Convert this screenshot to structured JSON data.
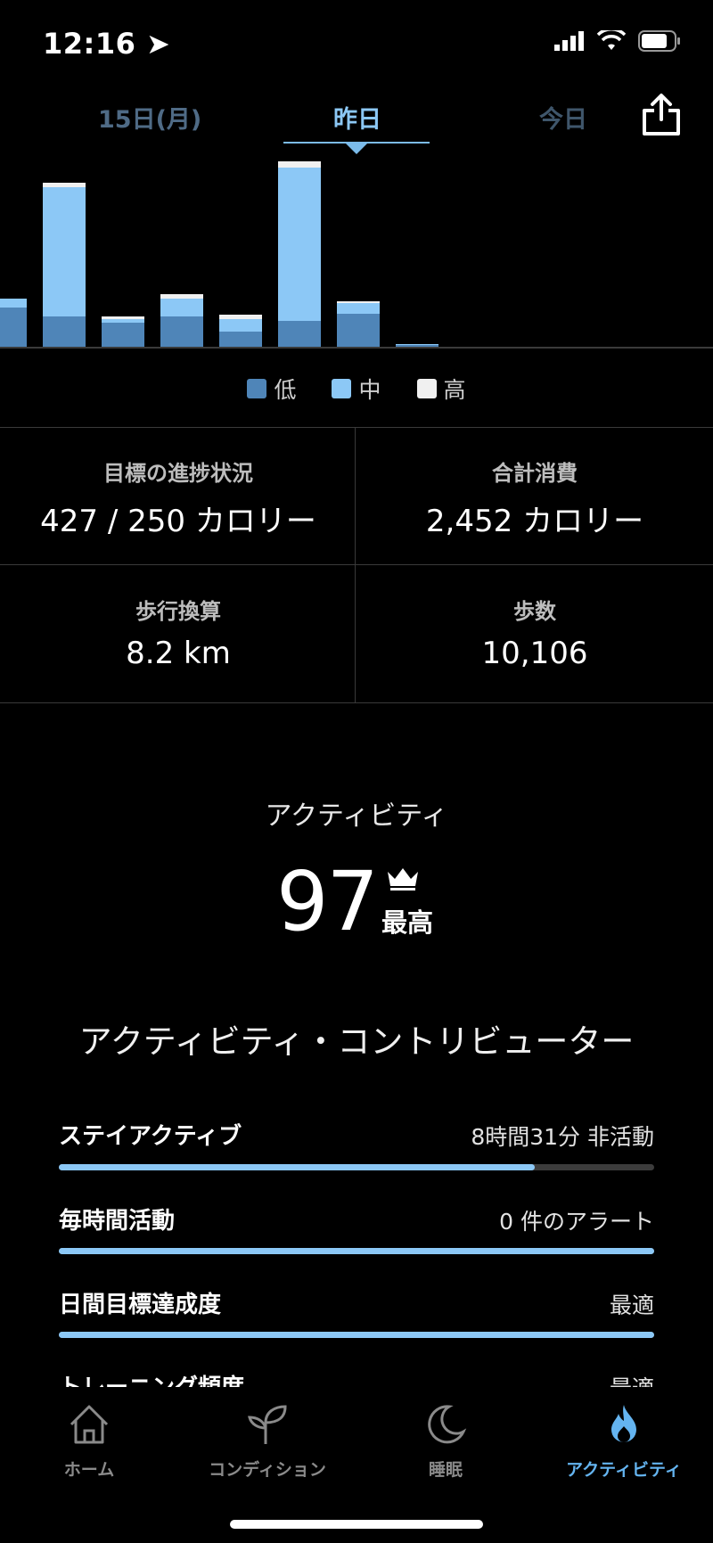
{
  "status": {
    "time": "12:16"
  },
  "date_tabs": {
    "prev": "15日(月)",
    "current": "昨日",
    "next": "今日"
  },
  "chart_data": {
    "type": "bar",
    "legend": [
      "低",
      "中",
      "高"
    ],
    "series": [
      {
        "name": "低",
        "values": [
          45,
          35,
          28,
          35,
          18,
          30,
          38,
          3
        ]
      },
      {
        "name": "中",
        "values": [
          10,
          145,
          4,
          20,
          14,
          172,
          12,
          1
        ]
      },
      {
        "name": "高",
        "values": [
          0,
          5,
          3,
          5,
          5,
          7,
          2,
          0
        ]
      }
    ],
    "colors": {
      "low": "#4f85b8",
      "mid": "#8cc8f6",
      "high": "#f0f0f0"
    }
  },
  "stats": {
    "goal_label": "目標の進捗状況",
    "goal_value": "427 / 250 カロリー",
    "total_label": "合計消費",
    "total_value": "2,452 カロリー",
    "walk_label": "歩行換算",
    "walk_value": "8.2 km",
    "steps_label": "歩数",
    "steps_value": "10,106"
  },
  "activity": {
    "title": "アクティビティ",
    "score": "97",
    "rating": "最高"
  },
  "contributors": {
    "title": "アクティビティ・コントリビューター",
    "items": [
      {
        "label": "ステイアクティブ",
        "value": "8時間31分 非活動",
        "progress": 0.8
      },
      {
        "label": "毎時間活動",
        "value": "0 件のアラート",
        "progress": 1.0
      },
      {
        "label": "日間目標達成度",
        "value": "最適",
        "progress": 1.0
      },
      {
        "label": "トレーニング頻度",
        "value": "最適",
        "progress": 1.0
      }
    ]
  },
  "nav": {
    "items": [
      {
        "label": "ホーム",
        "icon": "home-icon"
      },
      {
        "label": "コンディション",
        "icon": "sprout-icon"
      },
      {
        "label": "睡眠",
        "icon": "moon-icon"
      },
      {
        "label": "アクティビティ",
        "icon": "flame-icon"
      }
    ],
    "active_index": 3
  },
  "accent": "#8cc8f6"
}
